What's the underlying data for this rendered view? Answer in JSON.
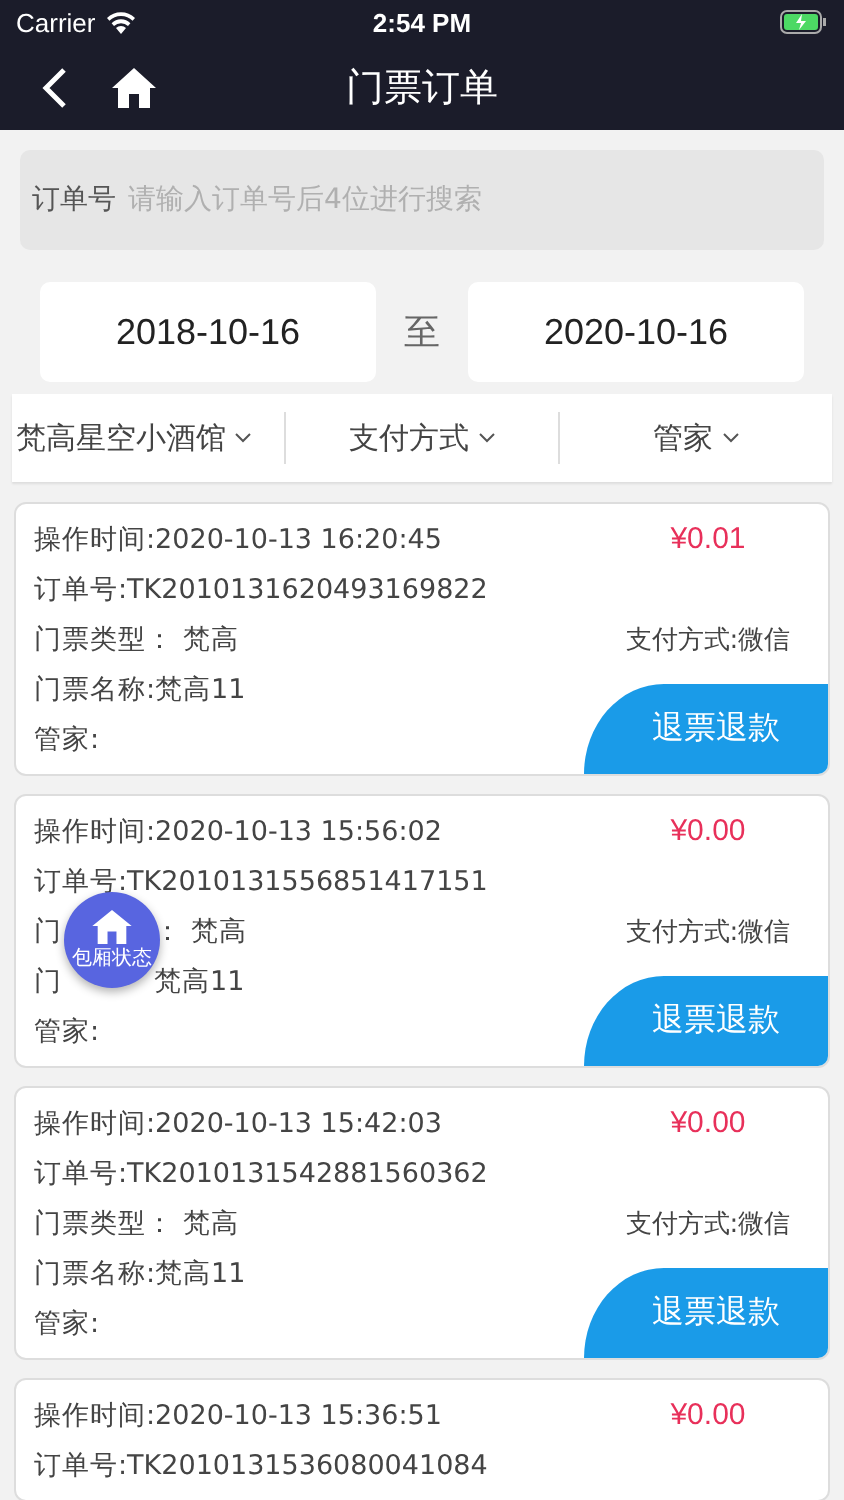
{
  "status_bar": {
    "carrier": "Carrier",
    "time": "2:54 PM"
  },
  "nav": {
    "title": "门票订单"
  },
  "search": {
    "label": "订单号",
    "placeholder": "请输入订单号后4位进行搜索"
  },
  "date_range": {
    "start": "2018-10-16",
    "separator": "至",
    "end": "2020-10-16"
  },
  "filters": [
    "梵高星空小酒馆",
    "支付方式",
    "管家"
  ],
  "orders": [
    {
      "time": "操作时间:2020-10-13 16:20:45",
      "order_no": "订单号:TK2010131620493169822",
      "price": "¥0.01",
      "ticket_type": [
        "门票类型：  梵高"
      ],
      "payment": "支付方式:微信",
      "ticket_name": [
        "门票名称:梵高11"
      ],
      "butler": "管家:",
      "action": "退票退款"
    },
    {
      "time": "操作时间:2020-10-13 15:56:02",
      "order_no": "订单号:TK2010131556851417151",
      "price": "¥0.00",
      "ticket_type": [
        "门",
        "：  梵高"
      ],
      "payment": "支付方式:微信",
      "ticket_name": [
        "门",
        "梵高11"
      ],
      "butler": "管家:",
      "action": "退票退款"
    },
    {
      "time": "操作时间:2020-10-13 15:42:03",
      "order_no": "订单号:TK2010131542881560362",
      "price": "¥0.00",
      "ticket_type": [
        "门票类型：  梵高"
      ],
      "payment": "支付方式:微信",
      "ticket_name": [
        "门票名称:梵高11"
      ],
      "butler": "管家:",
      "action": "退票退款"
    },
    {
      "time": "操作时间:2020-10-13 15:36:51",
      "order_no": "订单号:TK2010131536080041084",
      "price": "¥0.00"
    }
  ],
  "floating_button": {
    "label": "包厢状态"
  }
}
